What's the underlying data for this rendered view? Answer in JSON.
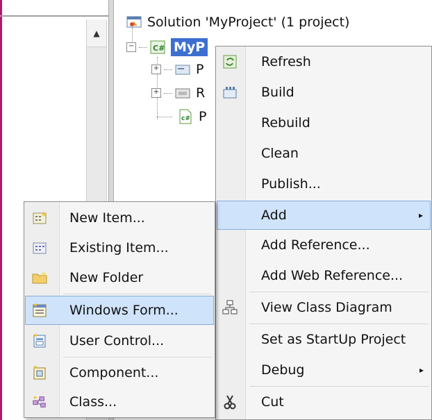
{
  "solution_explorer": {
    "tree": {
      "solution_label": "Solution 'MyProject' (1 project)",
      "project_label": "MyP",
      "children": [
        {
          "label": "P"
        },
        {
          "label": "R"
        },
        {
          "label": "P"
        }
      ]
    }
  },
  "context_menu": {
    "items": [
      {
        "label": "Refresh",
        "icon": "refresh-icon"
      },
      {
        "label": "Build",
        "icon": "build-icon"
      },
      {
        "label": "Rebuild"
      },
      {
        "label": "Clean"
      },
      {
        "label": "Publish..."
      },
      {
        "label": "Add",
        "submenu": true,
        "highlighted": true
      },
      {
        "label": "Add Reference..."
      },
      {
        "label": "Add Web Reference..."
      },
      {
        "label": "View Class Diagram",
        "icon": "class-diagram-icon"
      },
      {
        "label": "Set as StartUp Project"
      },
      {
        "label": "Debug",
        "submenu": true
      },
      {
        "label": "Cut",
        "icon": "cut-icon"
      }
    ],
    "submenu_arrow": "▸"
  },
  "add_submenu": {
    "items": [
      {
        "label": "New Item...",
        "icon": "new-item-icon"
      },
      {
        "label": "Existing Item...",
        "icon": "existing-item-icon"
      },
      {
        "label": "New Folder",
        "icon": "new-folder-icon"
      },
      {
        "label": "Windows Form...",
        "icon": "windows-form-icon",
        "highlighted": true
      },
      {
        "label": "User Control...",
        "icon": "user-control-icon"
      },
      {
        "label": "Component...",
        "icon": "component-icon"
      },
      {
        "label": "Class...",
        "icon": "class-icon"
      }
    ]
  },
  "colors": {
    "highlight_bg": "#cfe3fb",
    "highlight_border": "#84acdd",
    "selection_bg": "#3d6fd0",
    "menu_bg": "#f5f5f5"
  }
}
